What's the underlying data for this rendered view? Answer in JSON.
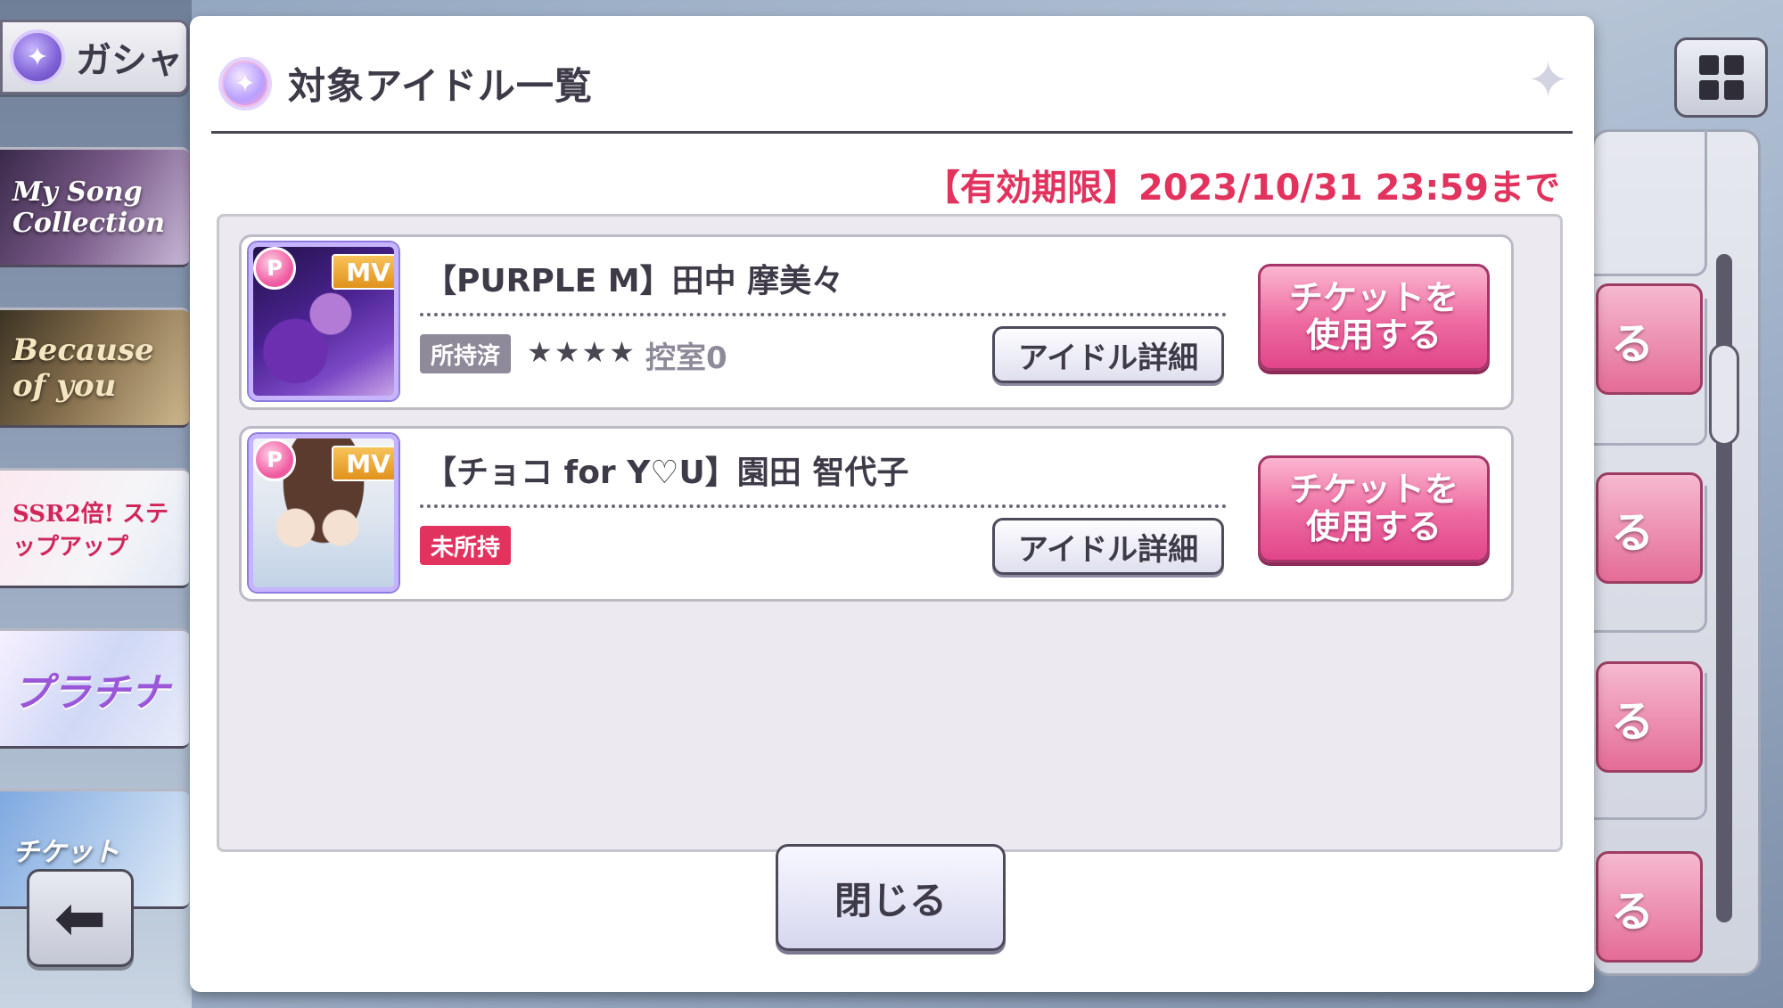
{
  "background": {
    "gacha_tab_label": "ガシャ",
    "banners": [
      "My Song Collection",
      "Because of you",
      "SSR2倍! ステップアップ",
      "プラチナ",
      "チケット"
    ],
    "side_button_label": "る",
    "back_icon": "arrow-left-icon",
    "menu_icon": "grid-icon"
  },
  "dialog": {
    "title": "対象アイドル一覧",
    "expiry": "【有効期限】2023/10/31 23:59まで",
    "idols": [
      {
        "name": "【PURPLE M】田中 摩美々",
        "status": "所持済",
        "stars": "★★★★",
        "room": "控室0",
        "p_badge": "P",
        "mv_badge": "MV",
        "detail_label": "アイドル詳細",
        "ticket_label": "チケットを\n使用する"
      },
      {
        "name": "【チョコ for Y♡U】園田 智代子",
        "status": "未所持",
        "p_badge": "P",
        "mv_badge": "MV",
        "detail_label": "アイドル詳細",
        "ticket_label": "チケットを\n使用する"
      }
    ],
    "close_label": "閉じる"
  },
  "colors": {
    "accent_pink": "#e2335e",
    "button_pink": "#ee6aa0",
    "text_dark": "#3e3a48"
  }
}
